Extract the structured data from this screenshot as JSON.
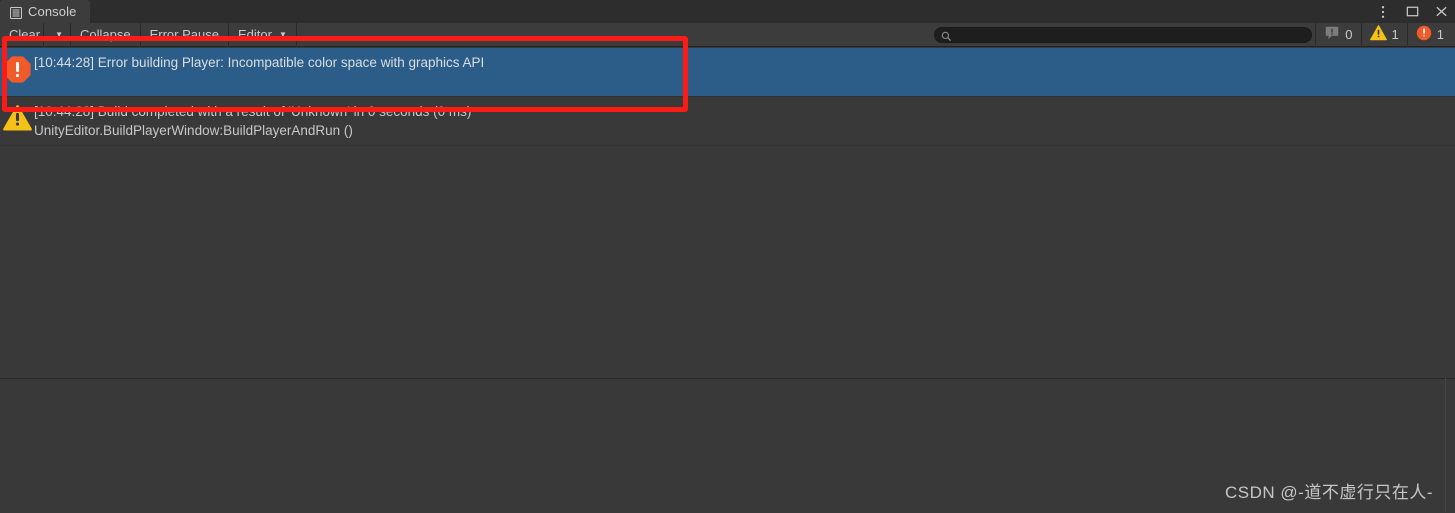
{
  "window": {
    "tab": {
      "label": "Console",
      "icon": "console-list-icon"
    },
    "controls": [
      {
        "name": "more-options-icon",
        "glyph": "kebab"
      },
      {
        "name": "maximize-icon",
        "glyph": "square"
      },
      {
        "name": "close-icon",
        "glyph": "cross"
      }
    ]
  },
  "toolbar": {
    "clear_label": "Clear",
    "clear_caret": "▼",
    "collapse_label": "Collapse",
    "error_pause_label": "Error Pause",
    "editor_label": "Editor",
    "editor_caret": "▼",
    "search": {
      "value": "",
      "placeholder": "",
      "icon": "search-icon"
    },
    "counters": [
      {
        "name": "info-count",
        "icon": "info-bubble-icon",
        "count": "0",
        "color": "#7d7d7d"
      },
      {
        "name": "warning-count",
        "icon": "warning-triangle-icon",
        "count": "1",
        "color": "#f5c116"
      },
      {
        "name": "error-count",
        "icon": "error-circle-icon",
        "count": "1",
        "color": "#f15a29"
      }
    ]
  },
  "log": {
    "rows": [
      {
        "type": "error",
        "icon": "error-octagon-icon",
        "selected": true,
        "line1": "[10:44:28] Error building Player: Incompatible color space with graphics API",
        "line2": ""
      },
      {
        "type": "warning",
        "icon": "warning-triangle-icon",
        "selected": false,
        "line1": "[10:44:28] Build completed with a result of 'Unknown' in 0 seconds (0 ms)",
        "line2": "UnityEditor.BuildPlayerWindow:BuildPlayerAndRun ()"
      }
    ]
  },
  "detail": {
    "text": ""
  },
  "annotation": {
    "name": "red-highlight-box",
    "color": "#fc1b15"
  },
  "watermark": {
    "text": "CSDN @-道不虚行只在人-"
  },
  "colors": {
    "background": "#393939",
    "toolbar": "#3c3c3c",
    "tabbar": "#2d2d2d",
    "selection": "#2c5c88",
    "error": "#f15a29",
    "warning": "#f5c116",
    "annotation": "#fc1b15"
  }
}
